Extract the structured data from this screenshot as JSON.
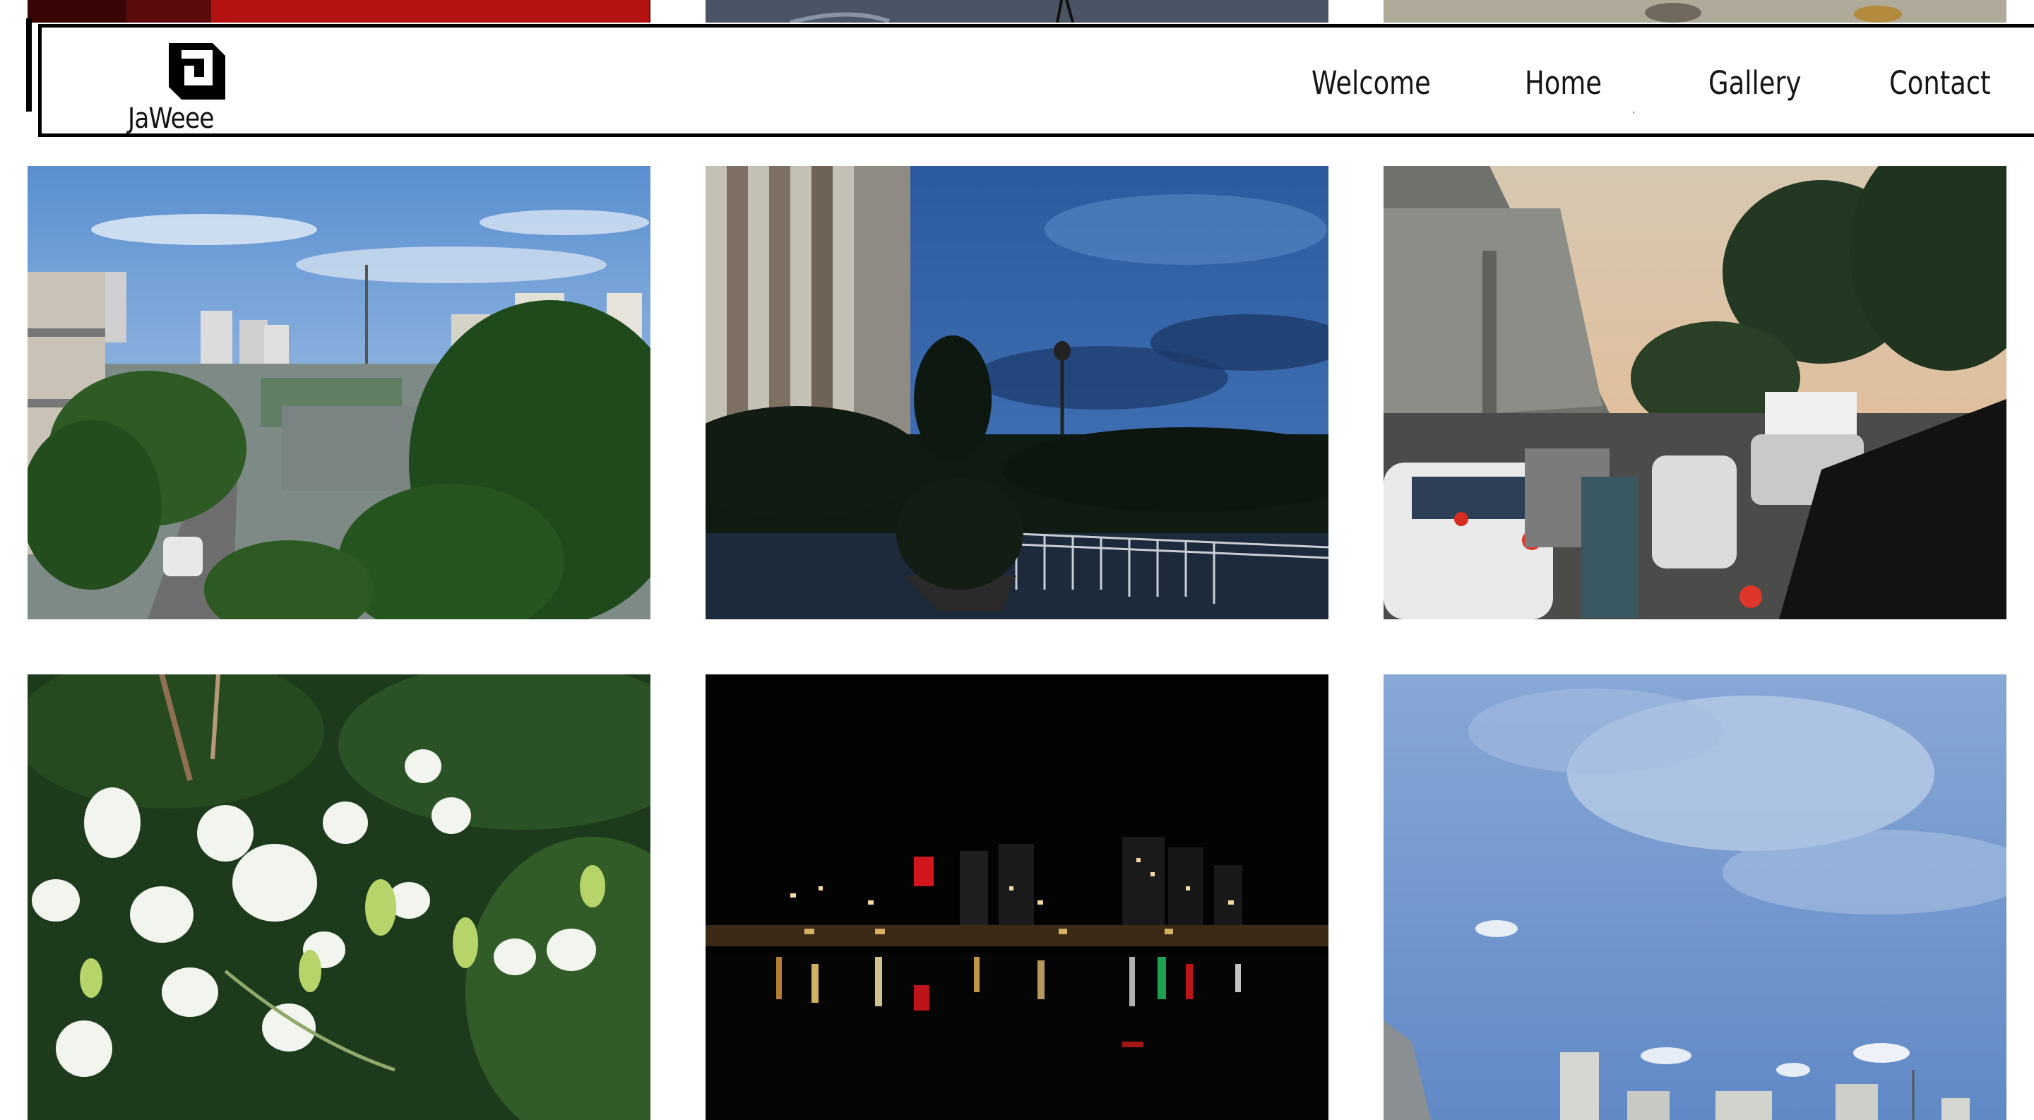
{
  "brand": {
    "name": "JaWeee",
    "logo_icon": "jaweee-logo-icon"
  },
  "nav": {
    "items": [
      {
        "label": "Welcome"
      },
      {
        "label": "Home"
      },
      {
        "label": "Gallery"
      },
      {
        "label": "Contact"
      }
    ]
  },
  "colors": {
    "background": "#ffffff",
    "header_border": "#000000",
    "text": "#151515"
  },
  "gallery": {
    "photos": [
      {
        "subject": "dark-red-scene"
      },
      {
        "subject": "dusk-street-with-pole"
      },
      {
        "subject": "paved-ground-with-leaf"
      },
      {
        "subject": "city-street-daytime"
      },
      {
        "subject": "high-rise-at-dusk"
      },
      {
        "subject": "traffic-under-overpass"
      },
      {
        "subject": "white-orchids"
      },
      {
        "subject": "lake-at-night"
      },
      {
        "subject": "blue-sky-skyline"
      }
    ]
  }
}
